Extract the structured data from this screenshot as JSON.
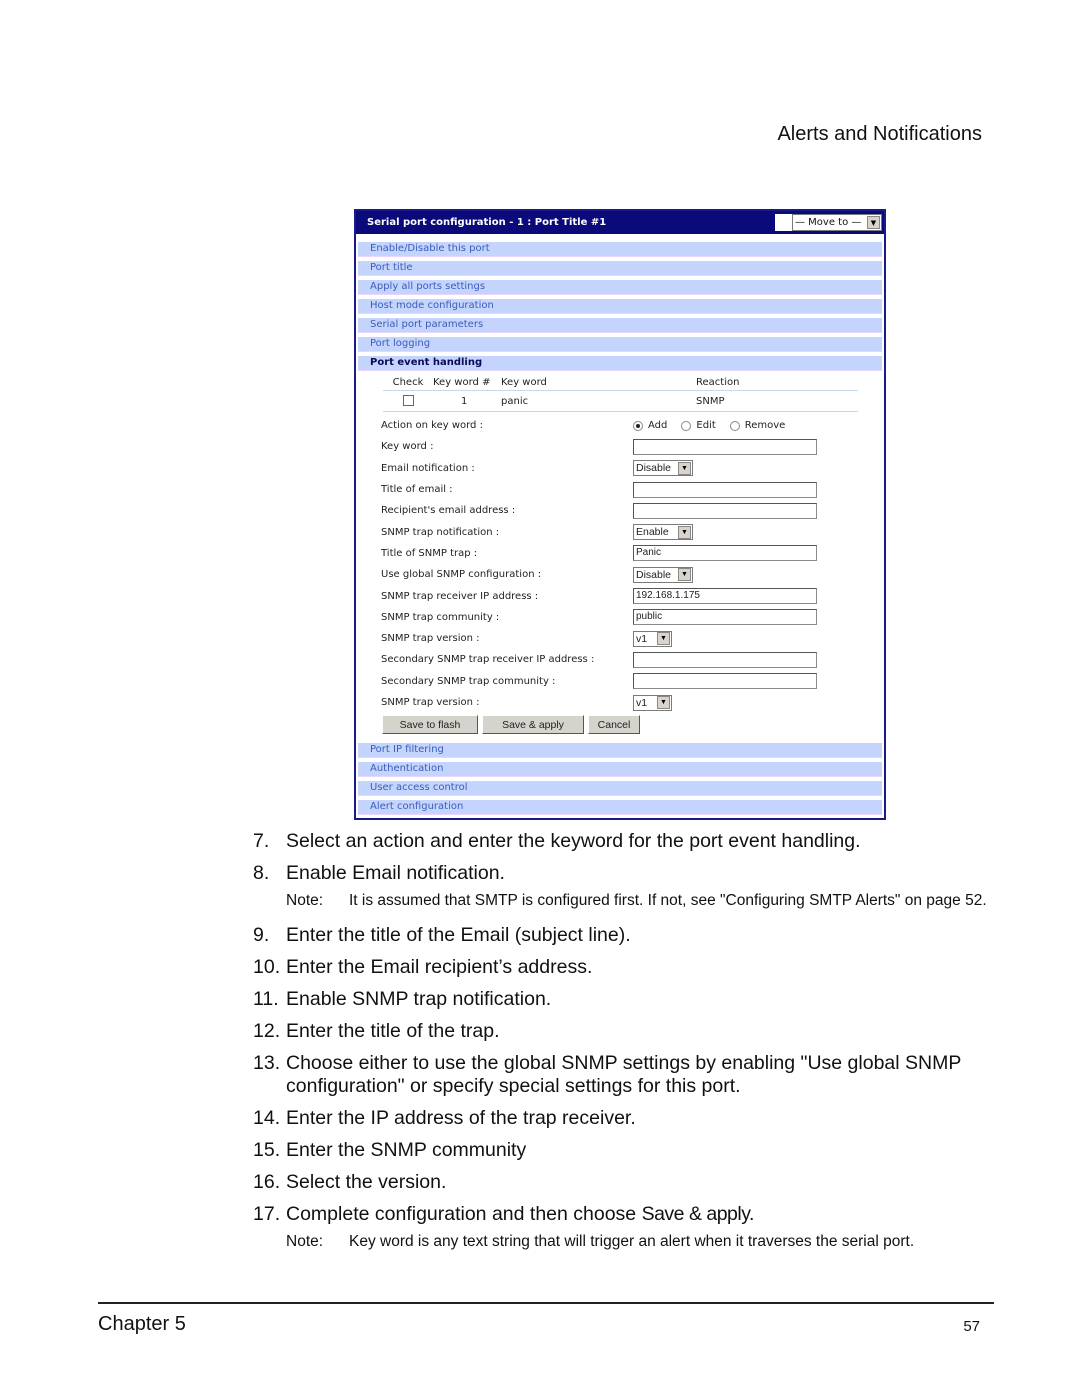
{
  "running_head": "Alerts and Notifications",
  "panel": {
    "title": "Serial port configuration - 1 : Port Title #1",
    "move_to": {
      "selected": "— Move to —",
      "arrow": "▼"
    },
    "nav_top": [
      {
        "label": "Enable/Disable this port",
        "active": false
      },
      {
        "label": "Port title",
        "active": false
      },
      {
        "label": "Apply all ports settings",
        "active": false
      },
      {
        "label": "Host mode configuration",
        "active": false
      },
      {
        "label": "Serial port parameters",
        "active": false
      },
      {
        "label": "Port logging",
        "active": false
      },
      {
        "label": "Port event handling",
        "active": true
      }
    ],
    "keyword_table": {
      "headers": {
        "check": "Check",
        "num": "Key word #",
        "keyword": "Key word",
        "reaction": "Reaction"
      },
      "rows": [
        {
          "checked": false,
          "num": "1",
          "keyword": "panic",
          "reaction": "SNMP"
        }
      ]
    },
    "form": {
      "action_label": "Action on key word :",
      "action_options": [
        "Add",
        "Edit",
        "Remove"
      ],
      "action_selected": "Add",
      "keyword_label": "Key word :",
      "keyword_value": "",
      "email_notification_label": "Email notification :",
      "email_notification_value": "Disable",
      "email_title_label": "Title of email :",
      "email_title_value": "",
      "recipient_label": "Recipient's email address :",
      "recipient_value": "",
      "snmp_notification_label": "SNMP trap notification :",
      "snmp_notification_value": "Enable",
      "snmp_title_label": "Title of SNMP trap :",
      "snmp_title_value": "Panic",
      "global_snmp_label": "Use global SNMP configuration :",
      "global_snmp_value": "Disable",
      "receiver_ip_label": "SNMP trap receiver IP address :",
      "receiver_ip_value": "192.168.1.175",
      "community_label": "SNMP trap community :",
      "community_value": "public",
      "version_label": "SNMP trap version :",
      "version_value": "v1",
      "secondary_ip_label": "Secondary SNMP trap receiver IP address :",
      "secondary_ip_value": "",
      "secondary_community_label": "Secondary SNMP trap community :",
      "secondary_community_value": "",
      "secondary_version_label": "SNMP trap version :",
      "secondary_version_value": "v1"
    },
    "buttons": {
      "save_flash": "Save to flash",
      "save_apply": "Save & apply",
      "cancel": "Cancel"
    },
    "nav_bottom": [
      {
        "label": "Port IP filtering"
      },
      {
        "label": "Authentication"
      },
      {
        "label": "User access control"
      },
      {
        "label": "Alert configuration"
      }
    ]
  },
  "steps": [
    {
      "num": "7.",
      "text": "Select an action and enter the keyword for the port event handling."
    },
    {
      "num": "8.",
      "text": "Enable Email notification."
    },
    {
      "num": "9.",
      "text": "Enter the title of the Email (subject line)."
    },
    {
      "num": "10.",
      "text": "Enter the Email recipient’s address."
    },
    {
      "num": "11.",
      "text": "Enable SNMP trap notification."
    },
    {
      "num": "12.",
      "text": "Enter the title of the trap."
    },
    {
      "num": "13.",
      "text": "Choose either to use the global SNMP settings by enabling \"Use global SNMP configuration\" or specify special settings for this port."
    },
    {
      "num": "14.",
      "text": "Enter the IP address of the trap receiver."
    },
    {
      "num": "15.",
      "text": "Enter the SNMP community"
    },
    {
      "num": "16.",
      "text": "Select the version."
    },
    {
      "num": "17.",
      "text": "Complete configuration and then choose ",
      "emph": "Save & apply."
    }
  ],
  "notes": {
    "label": "Note:",
    "smtp": "It is assumed that SMTP is configured first. If not, see \"Configuring SMTP Alerts\" on page 52.",
    "keyword": "Key word is any text string that will trigger an alert when it traverses the serial port."
  },
  "footer": {
    "chapter": "Chapter 5",
    "page": "57"
  }
}
